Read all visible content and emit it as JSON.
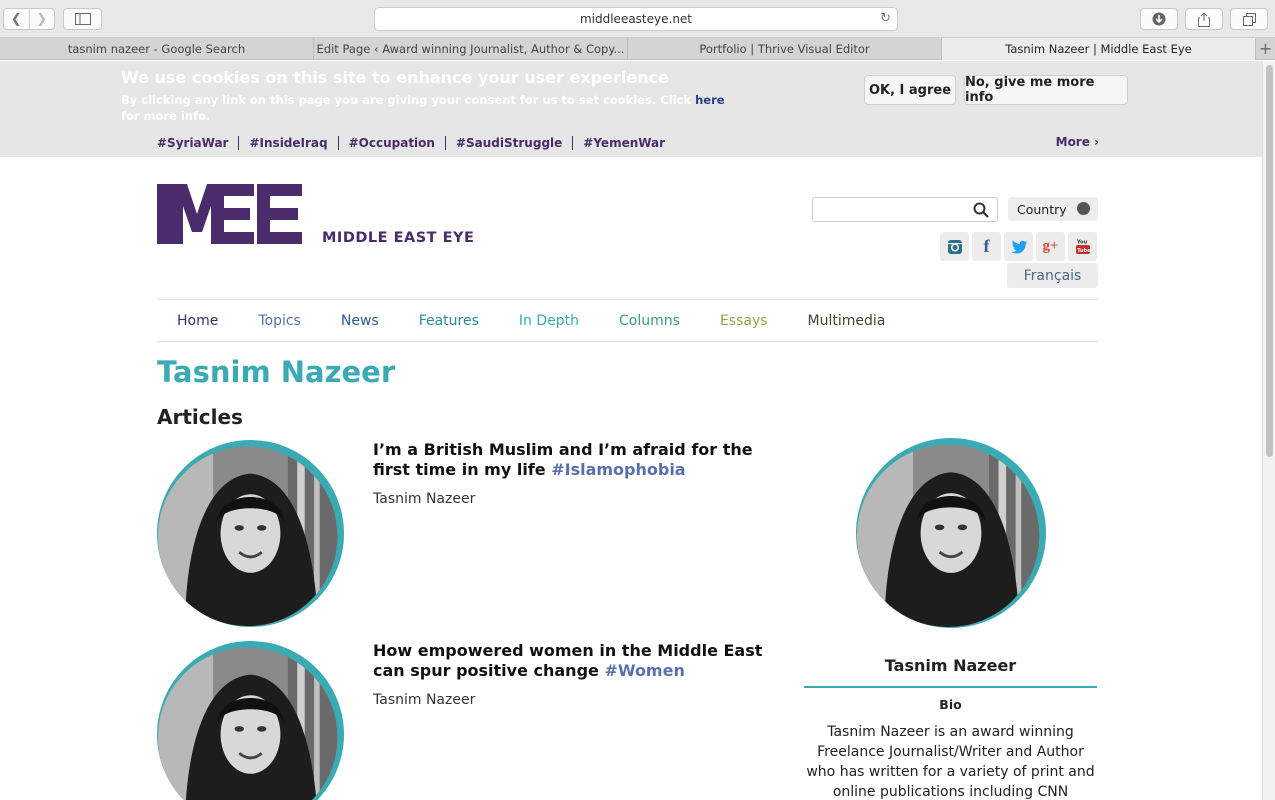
{
  "browser": {
    "url": "middleeasteye.net",
    "tabs": [
      {
        "label": "tasnim nazeer - Google Search",
        "active": false
      },
      {
        "label": "Edit Page ‹ Award winning Journalist, Author & Copy...",
        "active": false
      },
      {
        "label": "Portfolio | Thrive Visual Editor",
        "active": false
      },
      {
        "label": "Tasnim Nazeer | Middle East Eye",
        "active": true
      }
    ]
  },
  "cookie": {
    "title": "We use cookies on this site to enhance your user experience",
    "text_before": "By clicking any link on this page you are giving your consent for us to set cookies. Click ",
    "link": "here",
    "text_after": " for more info.",
    "agree_label": "OK, I agree",
    "more_label": "No, give me more info"
  },
  "hashtags": [
    "#SyriaWar",
    "#InsideIraq",
    "#Occupation",
    "#SaudiStruggle",
    "#YemenWar"
  ],
  "hashtags_more": "More ›",
  "header": {
    "logo_text": "MIDDLE EAST EYE",
    "country_label": "Country",
    "francais_label": "Français",
    "search_placeholder": ""
  },
  "nav": [
    {
      "label": "Home",
      "color": "#4a2b6b"
    },
    {
      "label": "Topics",
      "color": "#5a6fb0"
    },
    {
      "label": "News",
      "color": "#2a5c8f"
    },
    {
      "label": "Features",
      "color": "#2a8aa0"
    },
    {
      "label": "In Depth",
      "color": "#3aaab5"
    },
    {
      "label": "Columns",
      "color": "#3a9a8a"
    },
    {
      "label": "Essays",
      "color": "#8aa84a"
    },
    {
      "label": "Multimedia",
      "color": "#3a4a2a"
    }
  ],
  "page": {
    "author_name": "Tasnim Nazeer",
    "articles_heading": "Articles"
  },
  "articles": [
    {
      "title": "I’m a British Muslim and I’m afraid for the first time in my life",
      "tag": "#Islamophobia",
      "author": "Tasnim Nazeer"
    },
    {
      "title": "How empowered women in the Middle East can spur positive change",
      "tag": "#Women",
      "author": "Tasnim Nazeer"
    }
  ],
  "sidebar": {
    "name": "Tasnim Nazeer",
    "bio_label": "Bio",
    "bio_text": "Tasnim Nazeer is an award winning Freelance Journalist/Writer and Author who has written for a variety of print and online publications including CNN International,"
  },
  "colors": {
    "brand": "#4a2b6b",
    "accent": "#3aaab5",
    "tag": "#5a6fb0"
  }
}
